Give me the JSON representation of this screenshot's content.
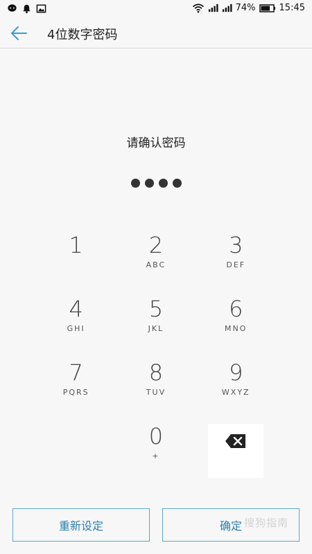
{
  "status_bar": {
    "battery_percent": "74%",
    "time": "15:45",
    "left_icons": [
      "chat-bubble-icon",
      "notification-bell-icon",
      "gallery-icon"
    ],
    "right_icons": [
      "wifi-icon",
      "signal-icon-1",
      "signal-icon-2",
      "battery-icon"
    ]
  },
  "header": {
    "title": "4位数字密码",
    "back_icon": "arrow-left-icon"
  },
  "prompt": "请确认密码",
  "pin": {
    "entered": 4,
    "length": 4
  },
  "keypad": {
    "keys": [
      {
        "digit": "1",
        "letters": ""
      },
      {
        "digit": "2",
        "letters": "ABC"
      },
      {
        "digit": "3",
        "letters": "DEF"
      },
      {
        "digit": "4",
        "letters": "GHI"
      },
      {
        "digit": "5",
        "letters": "JKL"
      },
      {
        "digit": "6",
        "letters": "MNO"
      },
      {
        "digit": "7",
        "letters": "PQRS"
      },
      {
        "digit": "8",
        "letters": "TUV"
      },
      {
        "digit": "9",
        "letters": "WXYZ"
      },
      {
        "digit": "0",
        "letters": "+"
      }
    ],
    "backspace_icon": "backspace-icon"
  },
  "buttons": {
    "reset": "重新设定",
    "ok": "确定"
  },
  "watermark": "搜狗指南",
  "colors": {
    "accent": "#2d7fb0",
    "border": "#5aa5c8",
    "background": "#f7f7f7",
    "dot": "#333333"
  }
}
